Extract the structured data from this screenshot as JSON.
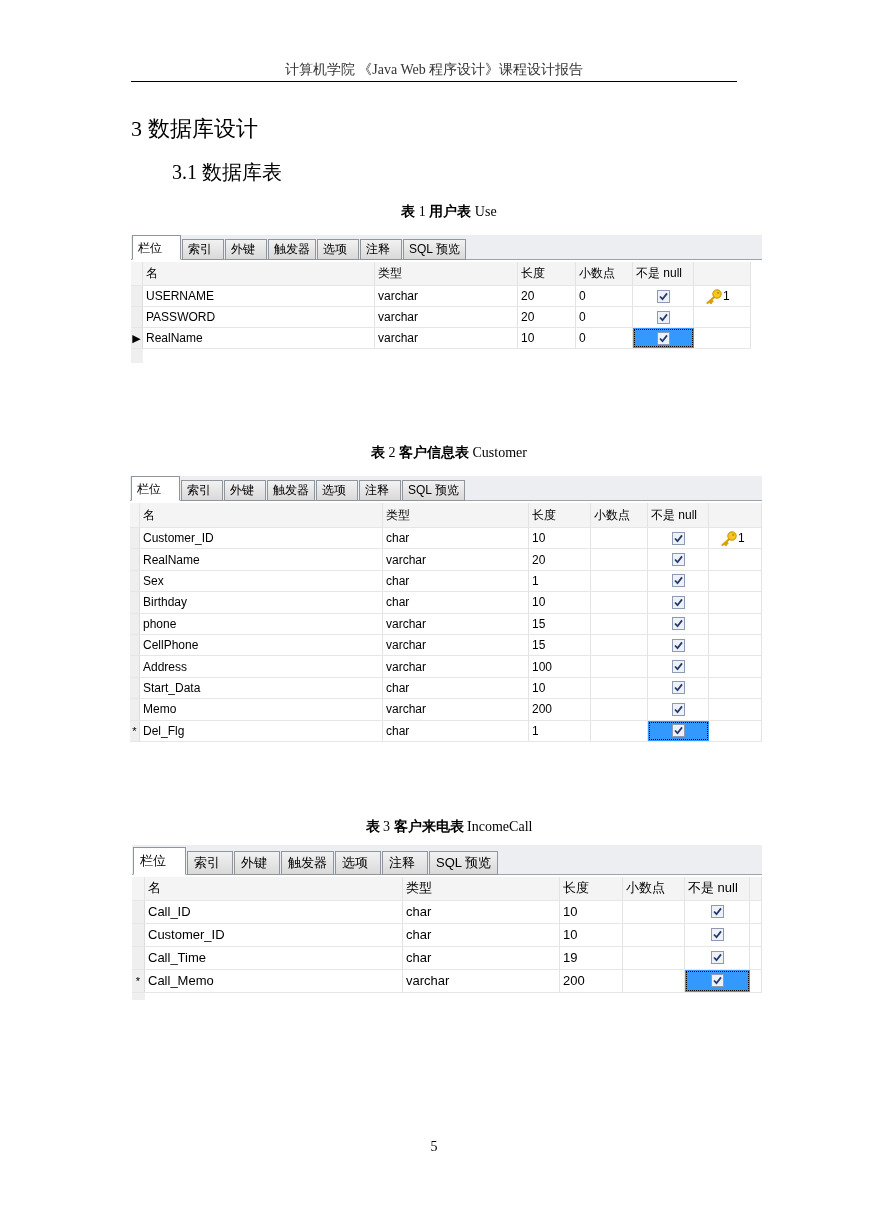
{
  "header": {
    "text": "计算机学院 《Java Web 程序设计》课程设计报告"
  },
  "heading": "3 数据库设计",
  "subheading": "3.1 数据库表",
  "tables": [
    {
      "caption": "**表** 1 **用户表** Use",
      "tabs": [
        {
          "label": "栏位",
          "selected": true
        },
        {
          "label": "索引",
          "selected": false
        },
        {
          "label": "外键",
          "selected": false
        },
        {
          "label": "触发器",
          "selected": false
        },
        {
          "label": "选项",
          "selected": false
        },
        {
          "label": "注释",
          "selected": false
        },
        {
          "label": "SQL 预览",
          "selected": false
        }
      ],
      "columns": [
        "名",
        "类型",
        "长度",
        "小数点",
        "不是 null"
      ],
      "rows": [
        {
          "name": "USERNAME",
          "type": "varchar",
          "length": "20",
          "decimal": "0",
          "not_null": true,
          "key": "1",
          "selected": false
        },
        {
          "name": "PASSWORD",
          "type": "varchar",
          "length": "20",
          "decimal": "0",
          "not_null": true,
          "selected": false
        },
        {
          "marker": "▶",
          "name": "RealName",
          "type": "varchar",
          "length": "10",
          "decimal": "0",
          "not_null": true,
          "selected": true
        }
      ]
    },
    {
      "caption": "**表** 2 **客户信息表** Customer",
      "tabs": [
        {
          "label": "栏位",
          "selected": true
        },
        {
          "label": "索引",
          "selected": false
        },
        {
          "label": "外键",
          "selected": false
        },
        {
          "label": "触发器",
          "selected": false
        },
        {
          "label": "选项",
          "selected": false
        },
        {
          "label": "注释",
          "selected": false
        },
        {
          "label": "SQL 预览",
          "selected": false
        }
      ],
      "columns": [
        "名",
        "类型",
        "长度",
        "小数点",
        "不是 null"
      ],
      "rows": [
        {
          "name": "Customer_ID",
          "type": "char",
          "length": "10",
          "not_null": true,
          "key": "1",
          "selected": false
        },
        {
          "name": "RealName",
          "type": "varchar",
          "length": "20",
          "not_null": true,
          "selected": false
        },
        {
          "name": "Sex",
          "type": "char",
          "length": "1",
          "not_null": true,
          "selected": false
        },
        {
          "name": "Birthday",
          "type": "char",
          "length": "10",
          "not_null": true,
          "selected": false
        },
        {
          "name": "phone",
          "type": "varchar",
          "length": "15",
          "not_null": true,
          "selected": false
        },
        {
          "name": "CellPhone",
          "type": "varchar",
          "length": "15",
          "not_null": true,
          "selected": false
        },
        {
          "name": "Address",
          "type": "varchar",
          "length": "100",
          "not_null": true,
          "selected": false
        },
        {
          "name": "Start_Data",
          "type": "char",
          "length": "10",
          "not_null": true,
          "selected": false
        },
        {
          "name": "Memo",
          "type": "varchar",
          "length": "200",
          "not_null": true,
          "selected": false
        },
        {
          "marker": "*",
          "name": "Del_Flg",
          "type": "char",
          "length": "1",
          "not_null": true,
          "selected": true
        }
      ]
    },
    {
      "caption": "**表** 3 **客户来电表** IncomeCall",
      "tabs": [
        {
          "label": "栏位",
          "selected": true
        },
        {
          "label": "索引",
          "selected": false
        },
        {
          "label": "外键",
          "selected": false
        },
        {
          "label": "触发器",
          "selected": false
        },
        {
          "label": "选项",
          "selected": false
        },
        {
          "label": "注释",
          "selected": false
        },
        {
          "label": "SQL 预览",
          "selected": false
        }
      ],
      "columns": [
        "名",
        "类型",
        "长度",
        "小数点",
        "不是 null"
      ],
      "rows": [
        {
          "name": "Call_ID",
          "type": "char",
          "length": "10",
          "not_null": true,
          "selected": false
        },
        {
          "name": "Customer_ID",
          "type": "char",
          "length": "10",
          "not_null": true,
          "selected": false
        },
        {
          "name": "Call_Time",
          "type": "char",
          "length": "19",
          "not_null": true,
          "selected": false
        },
        {
          "marker": "*",
          "name": "Call_Memo",
          "type": "varchar",
          "length": "200",
          "not_null": true,
          "selected": true
        }
      ]
    }
  ],
  "page_number": "5"
}
